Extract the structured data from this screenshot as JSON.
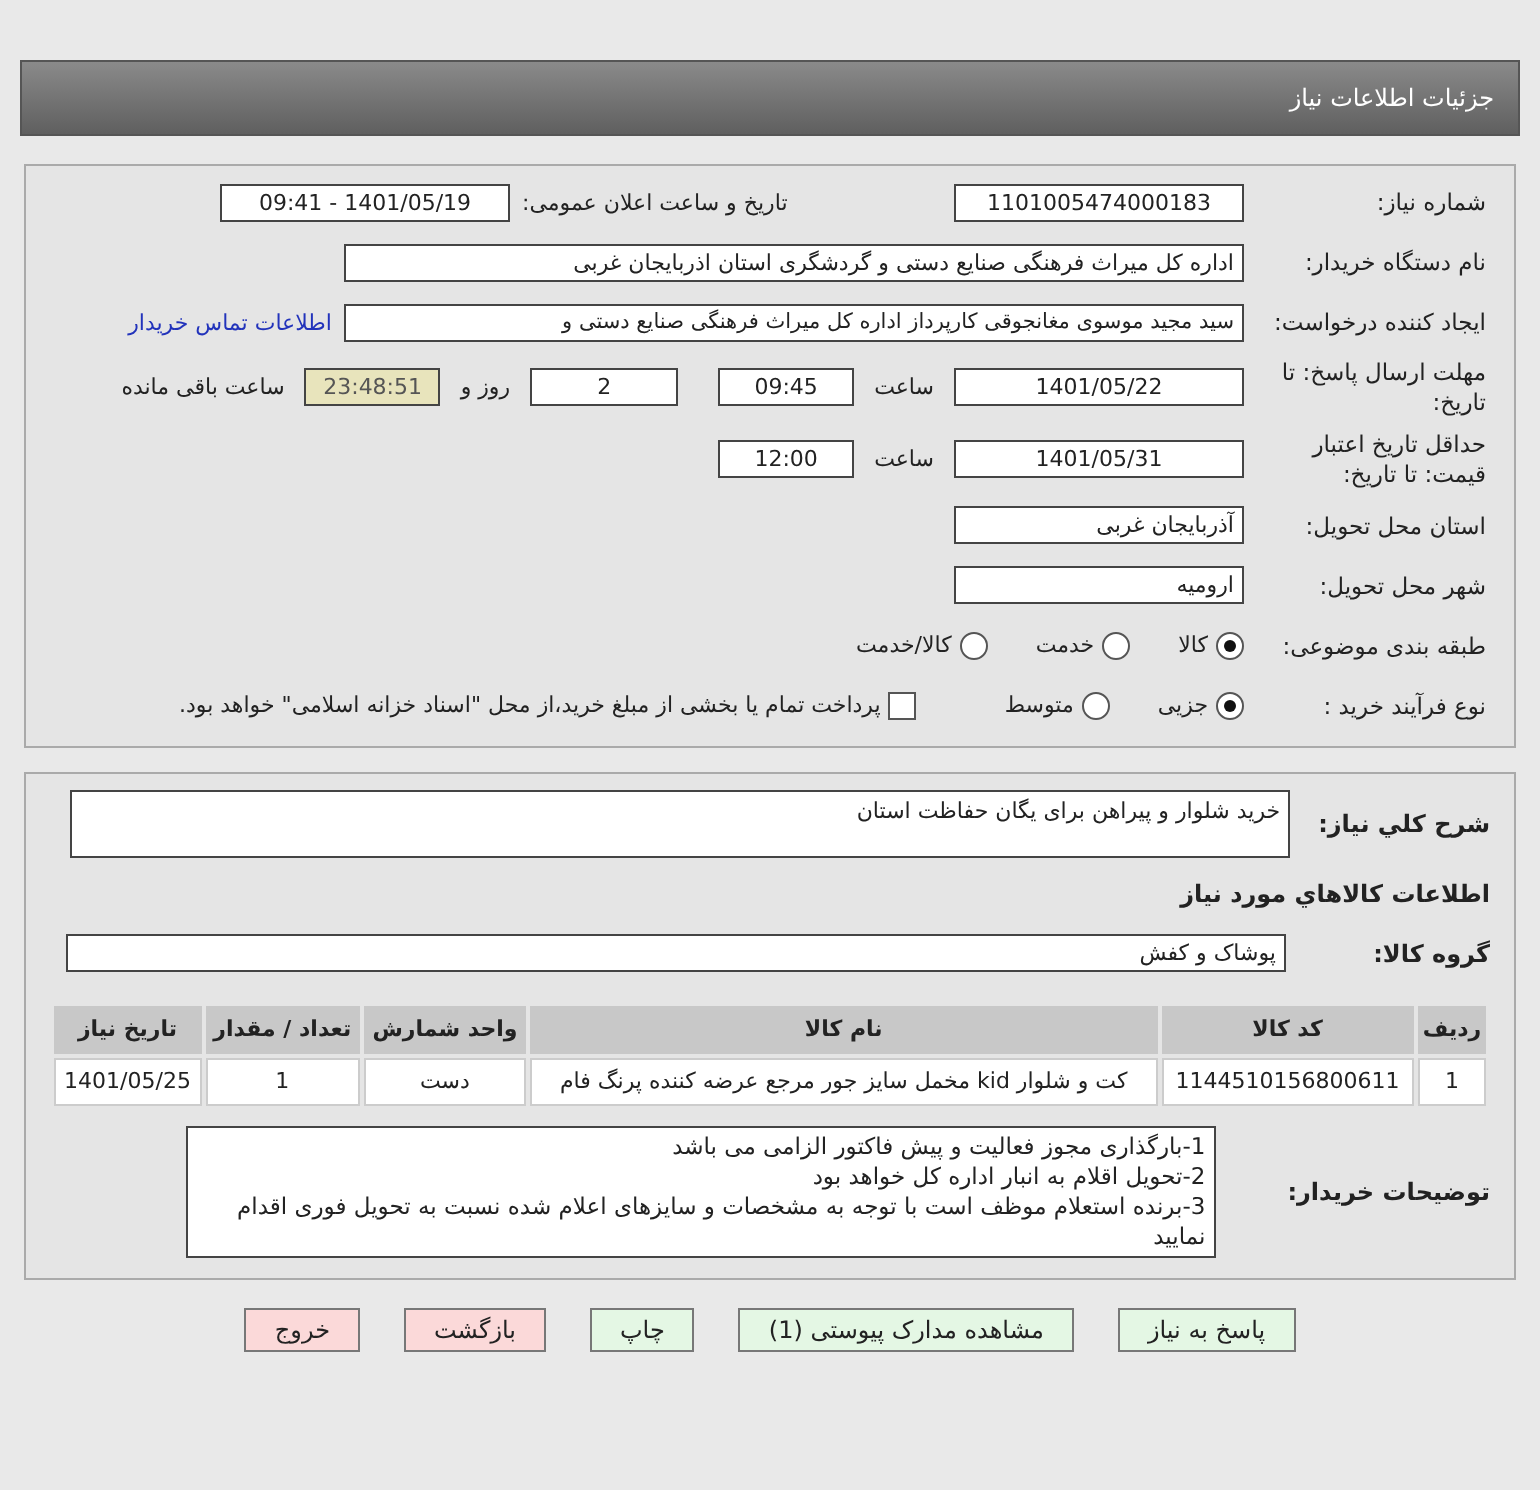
{
  "header": {
    "title": "جزئیات اطلاعات نیاز"
  },
  "need_number": {
    "label": "شماره نیاز:",
    "value": "1101005474000183"
  },
  "announce": {
    "label": "تاریخ و ساعت اعلان عمومی:",
    "value": "1401/05/19 - 09:41"
  },
  "buyer_org": {
    "label": "نام دستگاه خریدار:",
    "value": "اداره کل میراث فرهنگی  صنایع دستی و گردشگری استان اذربایجان غربی"
  },
  "requester": {
    "label": "ایجاد کننده درخواست:",
    "value": "سید مجید موسوی مغانجوقی کارپرداز اداره کل میراث فرهنگی  صنایع دستی و",
    "link": "اطلاعات تماس خریدار"
  },
  "deadline": {
    "label": "مهلت ارسال پاسخ: تا تاریخ:",
    "date": "1401/05/22",
    "time_label": "ساعت",
    "time": "09:45",
    "days": "2",
    "days_suffix": "روز و",
    "remaining": "23:48:51",
    "remaining_suffix": "ساعت باقی مانده"
  },
  "validity": {
    "label": "حداقل تاریخ اعتبار قیمت: تا تاریخ:",
    "date": "1401/05/31",
    "time_label": "ساعت",
    "time": "12:00"
  },
  "province": {
    "label": "استان محل تحویل:",
    "value": "آذربایجان غربی"
  },
  "city": {
    "label": "شهر محل تحویل:",
    "value": "ارومیه"
  },
  "category": {
    "label": "طبقه بندی موضوعی:",
    "options": [
      {
        "label": "کالا",
        "selected": true
      },
      {
        "label": "خدمت",
        "selected": false
      },
      {
        "label": "کالا/خدمت",
        "selected": false
      }
    ]
  },
  "process": {
    "label": "نوع فرآیند خرید :",
    "options": [
      {
        "label": "جزیی",
        "selected": true
      },
      {
        "label": "متوسط",
        "selected": false
      }
    ],
    "payment": {
      "checked": false,
      "text": "پرداخت تمام یا بخشی از مبلغ خرید،از محل \"اسناد خزانه اسلامی\" خواهد بود."
    }
  },
  "description": {
    "label": "شرح کلي نياز:",
    "value": "خرید شلوار و پیراهن برای یگان حفاظت استان"
  },
  "goods_title": "اطلاعات کالاهاي مورد نياز",
  "goods_group": {
    "label": "گروه کالا:",
    "value": "پوشاک و کفش"
  },
  "table": {
    "columns": [
      "ردیف",
      "کد کالا",
      "نام کالا",
      "واحد شمارش",
      "تعداد / مقدار",
      "تاریخ نیاز"
    ],
    "rows": [
      [
        "1",
        "1144510156800611",
        "کت و شلوار kid مخمل سایز جور مرجع عرضه کننده پرنگ فام",
        "دست",
        "1",
        "1401/05/25"
      ]
    ]
  },
  "buyer_notes": {
    "label": "توضیحات خریدار:",
    "lines": [
      "1-بارگذاری مجوز فعالیت و پیش فاکتور الزامی می باشد",
      "2-تحویل اقلام به انبار اداره کل خواهد بود",
      "3-برنده استعلام موظف است با توجه به مشخصات و سایزهای اعلام شده نسبت به تحویل فوری اقدام نمایید"
    ]
  },
  "buttons": [
    {
      "label": "پاسخ به نیاز",
      "kind": "green"
    },
    {
      "label": "مشاهده مدارک پیوستی (1)",
      "kind": "green"
    },
    {
      "label": "چاپ",
      "kind": "green"
    },
    {
      "label": "بازگشت",
      "kind": "red"
    },
    {
      "label": "خروج",
      "kind": "red"
    }
  ]
}
